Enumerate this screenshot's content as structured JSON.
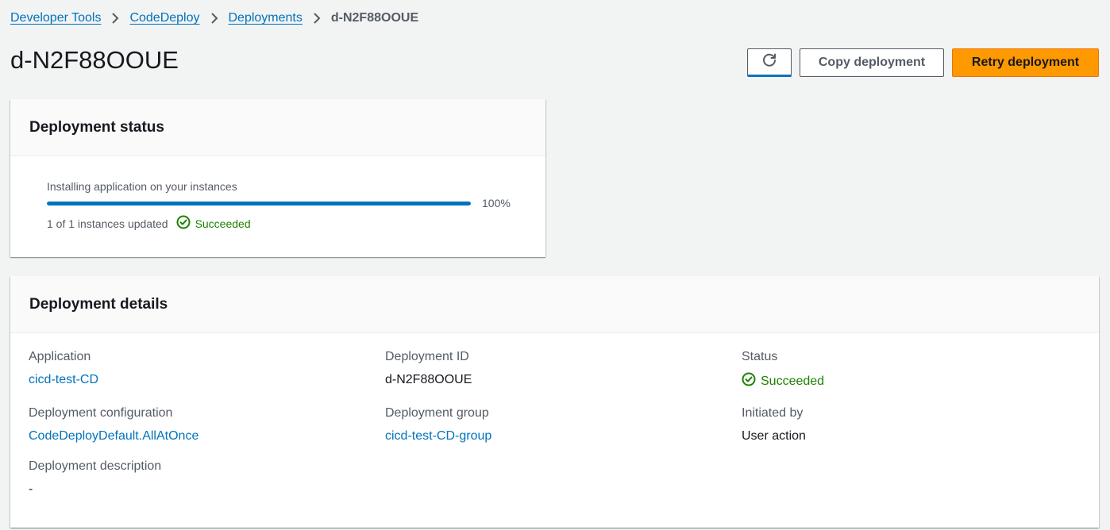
{
  "breadcrumb": [
    {
      "label": "Developer Tools"
    },
    {
      "label": "CodeDeploy"
    },
    {
      "label": "Deployments"
    }
  ],
  "breadcrumb_current": "d-N2F88OOUE",
  "page_title": "d-N2F88OOUE",
  "actions": {
    "refresh_icon": "refresh-icon",
    "copy_label": "Copy deployment",
    "retry_label": "Retry deployment"
  },
  "status_card": {
    "title": "Deployment status",
    "progress_label": "Installing application on your instances",
    "progress_percent": 100,
    "progress_text": "100%",
    "instances_text": "1 of 1 instances updated",
    "status_text": "Succeeded"
  },
  "details": {
    "title": "Deployment details",
    "application_label": "Application",
    "application_value": "cicd-test-CD",
    "deployment_id_label": "Deployment ID",
    "deployment_id_value": "d-N2F88OOUE",
    "status_label": "Status",
    "status_value": "Succeeded",
    "config_label": "Deployment configuration",
    "config_value": "CodeDeployDefault.AllAtOnce",
    "group_label": "Deployment group",
    "group_value": "cicd-test-CD-group",
    "initiated_label": "Initiated by",
    "initiated_value": "User action",
    "description_label": "Deployment description",
    "description_value": "-"
  },
  "colors": {
    "link": "#0073bb",
    "success": "#1d8102",
    "primary_button": "#ff9900",
    "progress": "#0073bb"
  }
}
